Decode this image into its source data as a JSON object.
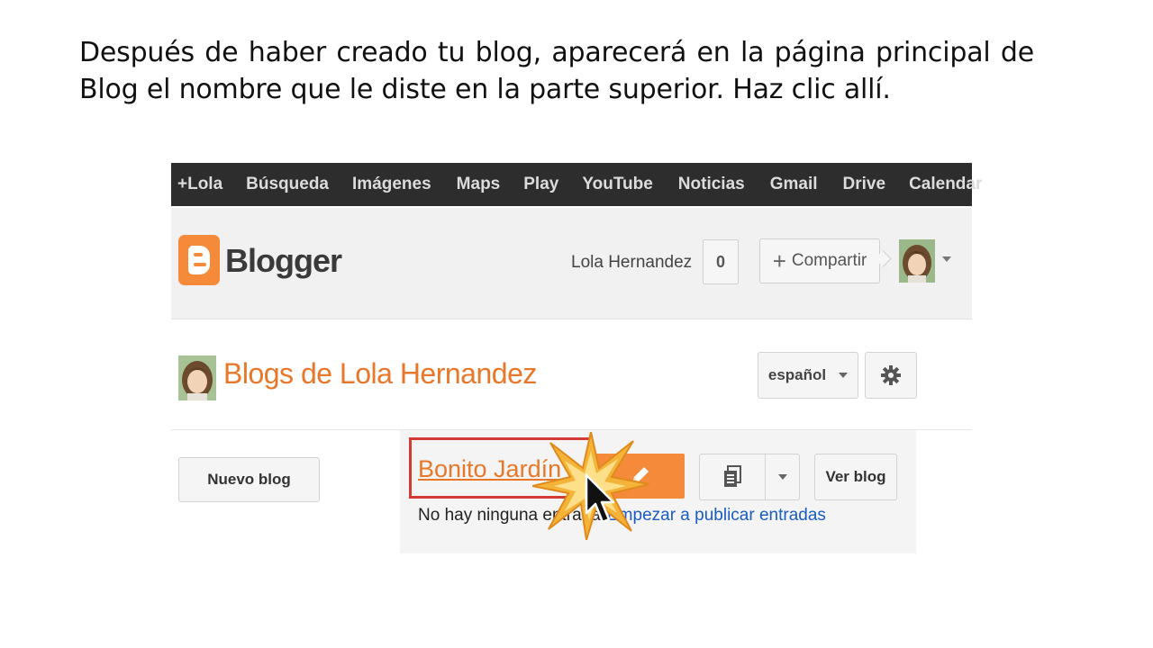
{
  "caption": "Después de haber creado tu blog, aparecerá en la página principal de Blog el nombre que le diste en la parte superior. Haz clic allí.",
  "gbar": {
    "items": [
      "+Lola",
      "Búsqueda",
      "Imágenes",
      "Maps",
      "Play",
      "YouTube",
      "Noticias",
      "Gmail",
      "Drive",
      "Calendar"
    ]
  },
  "header": {
    "logo_text": "Blogger",
    "username": "Lola Hernandez",
    "notification_count": "0",
    "share_label": "Compartir"
  },
  "blogs_section": {
    "title": "Blogs de Lola Hernandez",
    "language": "español"
  },
  "list": {
    "new_blog_label": "Nuevo blog",
    "blog_name": "Bonito Jardín",
    "view_blog_label": "Ver blog",
    "no_posts_text": "No hay ninguna entrada.",
    "start_posting_link": "Empezar a publicar entradas"
  },
  "colors": {
    "accent": "#f58b3a",
    "title_orange": "#e9772a",
    "highlight_red": "#d23a33",
    "link_blue": "#1a5cc0",
    "topbar": "#2d2d2d"
  },
  "icons": [
    "blogger-logo-icon",
    "avatar-icon",
    "gear-icon",
    "pencil-icon",
    "pages-icon",
    "chevron-down-icon",
    "mouse-cursor-icon",
    "click-burst-icon"
  ]
}
